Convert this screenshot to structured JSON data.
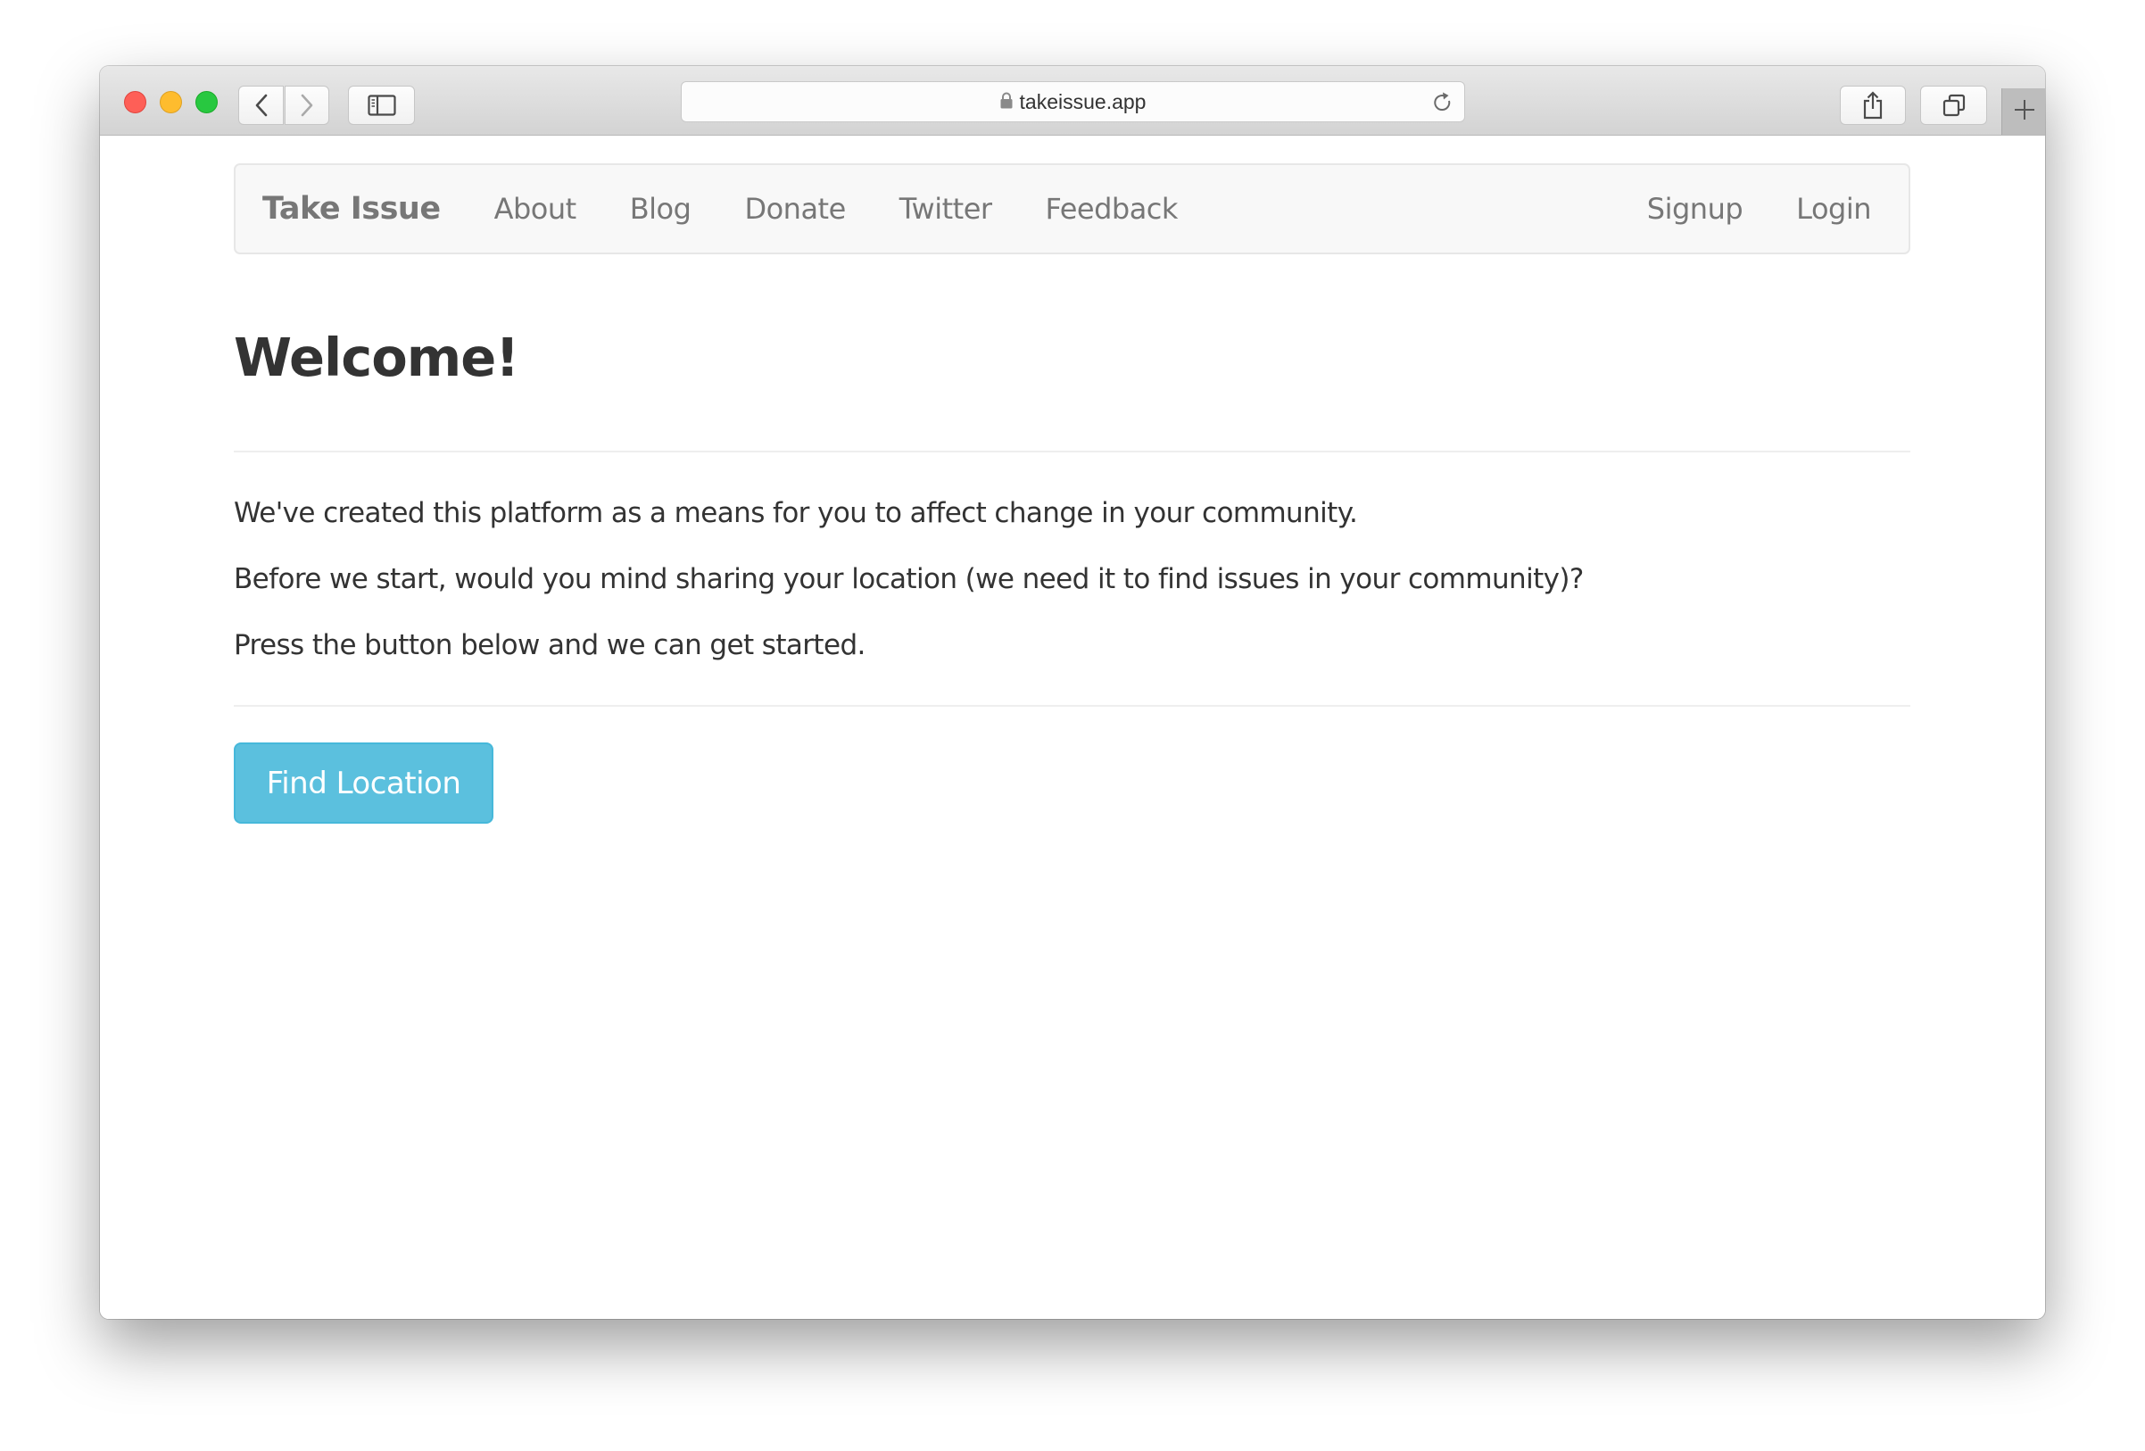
{
  "browser": {
    "url": "takeissue.app",
    "icons": {
      "back": "chevron-left-icon",
      "forward": "chevron-right-icon",
      "sidebar": "sidebar-icon",
      "lock": "lock-icon",
      "reload": "reload-icon",
      "share": "share-icon",
      "tabs": "tabs-icon",
      "new_tab": "plus-icon"
    }
  },
  "navbar": {
    "brand": "Take Issue",
    "left_links": [
      "About",
      "Blog",
      "Donate",
      "Twitter",
      "Feedback"
    ],
    "right_links": [
      "Signup",
      "Login"
    ]
  },
  "main": {
    "heading": "Welcome!",
    "paragraphs": [
      "We've created this platform as a means for you to affect change in your community.",
      "Before we start, would you mind sharing your location (we need it to find issues in your community)?",
      "Press the button below and we can get started."
    ],
    "button_label": "Find Location"
  },
  "colors": {
    "button_bg": "#5bc0de",
    "button_border": "#46b8da",
    "navbar_bg": "#f8f8f8",
    "nav_text": "#777777",
    "body_text": "#333333"
  }
}
